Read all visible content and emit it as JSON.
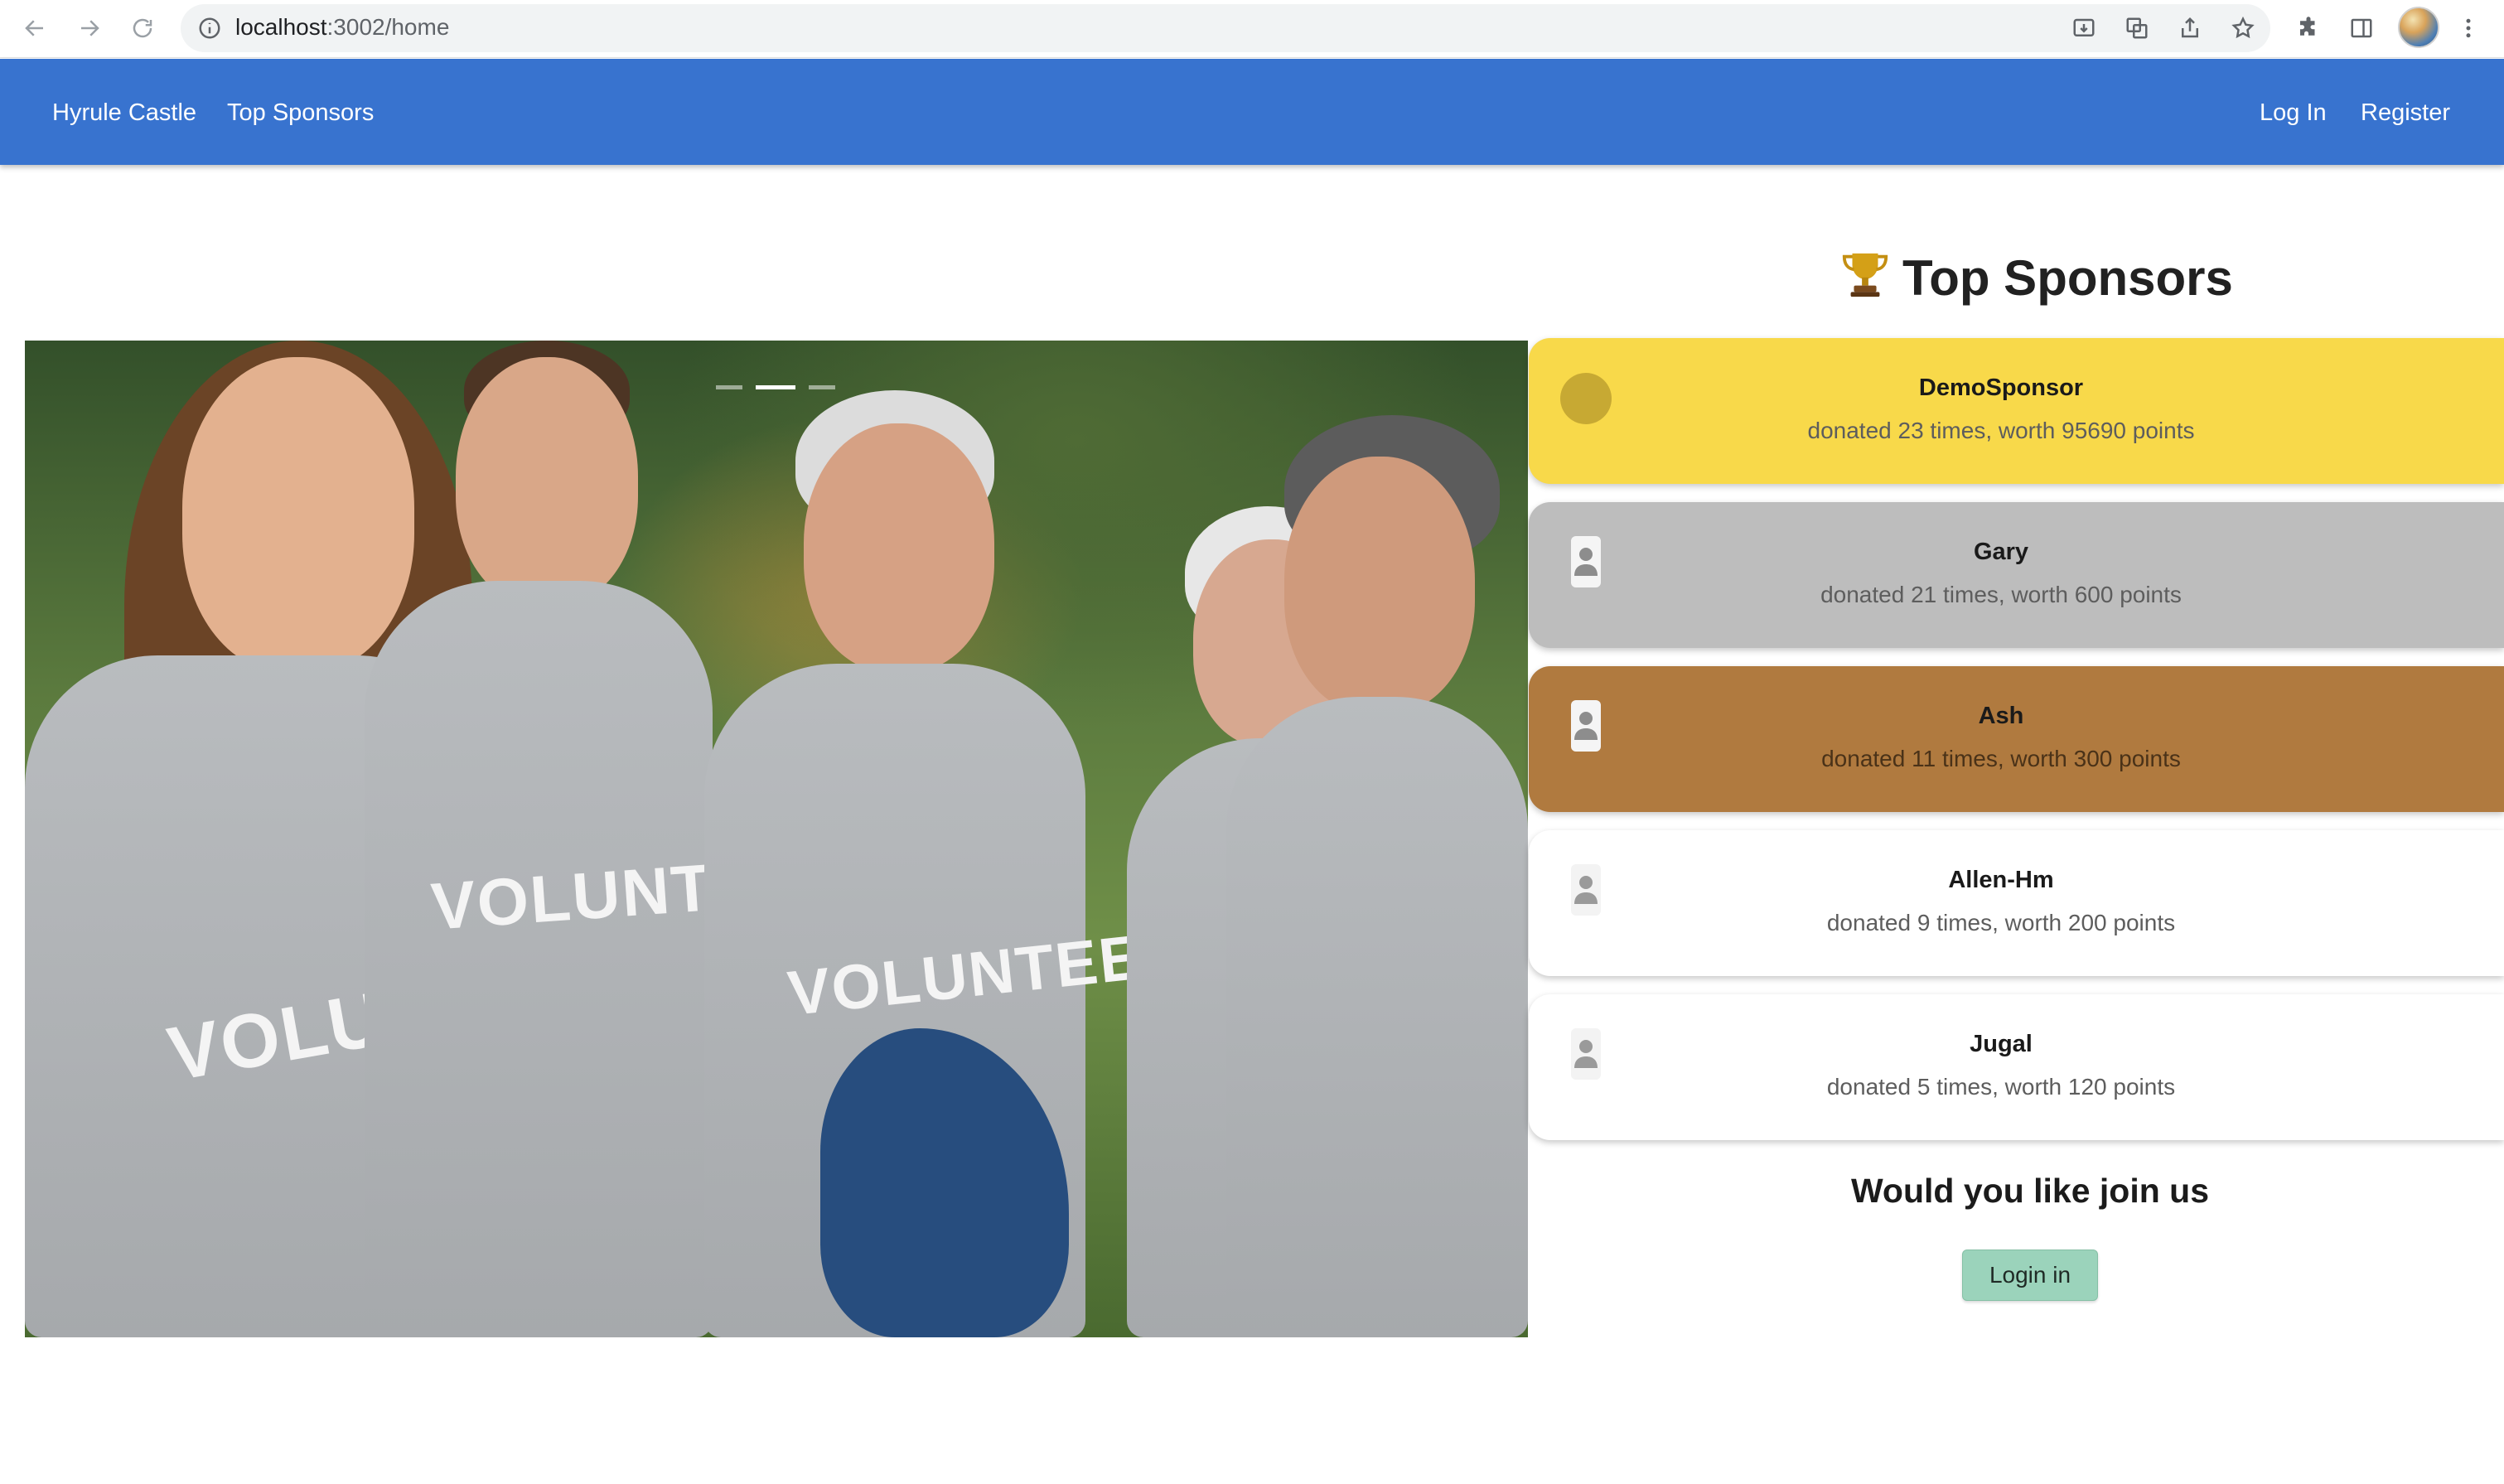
{
  "browser": {
    "url_host": "localhost",
    "url_path": ":3002/home",
    "icons": [
      "back-arrow-icon",
      "forward-arrow-icon",
      "reload-icon",
      "info-icon",
      "install-icon",
      "translate-icon",
      "share-icon",
      "bookmark-star-icon",
      "extensions-icon",
      "side-panel-icon",
      "profile-avatar",
      "more-menu-icon"
    ]
  },
  "navbar": {
    "background": "#3873cf",
    "brand": "Hyrule Castle",
    "links": [
      "Top Sponsors"
    ],
    "right_links": [
      "Log In",
      "Register"
    ]
  },
  "carousel": {
    "slide_count": 3,
    "active_index": 1,
    "shirt_text": "VOLUNTEER"
  },
  "sponsors": {
    "title": "Top Sponsors",
    "items": [
      {
        "name": "DemoSponsor",
        "detail": "donated 23 times, worth 95690 points",
        "color": "#f8d94a"
      },
      {
        "name": "Gary",
        "detail": "donated 21 times, worth 600 points",
        "color": "#bdbdbd"
      },
      {
        "name": "Ash",
        "detail": "donated 11 times, worth 300 points",
        "color": "#b07a3f"
      },
      {
        "name": "Allen-Hm",
        "detail": "donated 9 times, worth 200 points",
        "color": "#ffffff"
      },
      {
        "name": "Jugal",
        "detail": "donated 5 times, worth 120 points",
        "color": "#ffffff"
      }
    ]
  },
  "join": {
    "title": "Would you like join us",
    "button": "Login in"
  }
}
